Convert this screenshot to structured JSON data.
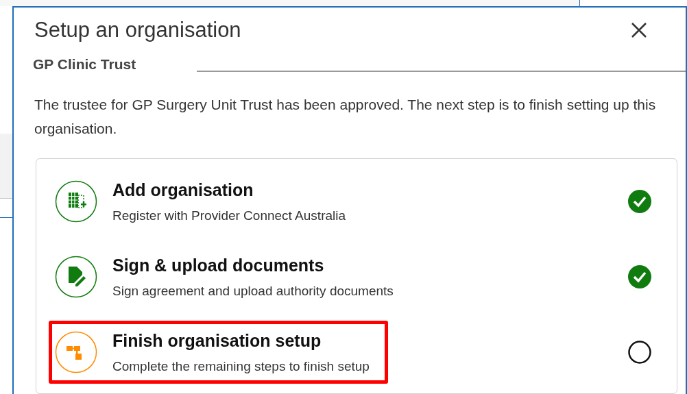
{
  "dialog": {
    "title": "Setup an organisation",
    "subtitle": "GP Clinic Trust",
    "message": "The trustee for GP Surgery Unit Trust has been approved. The next step is to finish setting up this organisation.",
    "steps": [
      {
        "kind": "building",
        "title": "Add organisation",
        "description": "Register with Provider Connect Australia",
        "color": "#107c10",
        "done": true,
        "highlighted": false
      },
      {
        "kind": "document",
        "title": "Sign & upload documents",
        "description": "Sign agreement and upload authority documents",
        "color": "#107c10",
        "done": true,
        "highlighted": false
      },
      {
        "kind": "hierarchy",
        "title": "Finish organisation setup",
        "description": "Complete the remaining steps to finish setup",
        "color": "#ff8c00",
        "done": false,
        "highlighted": true
      }
    ]
  }
}
